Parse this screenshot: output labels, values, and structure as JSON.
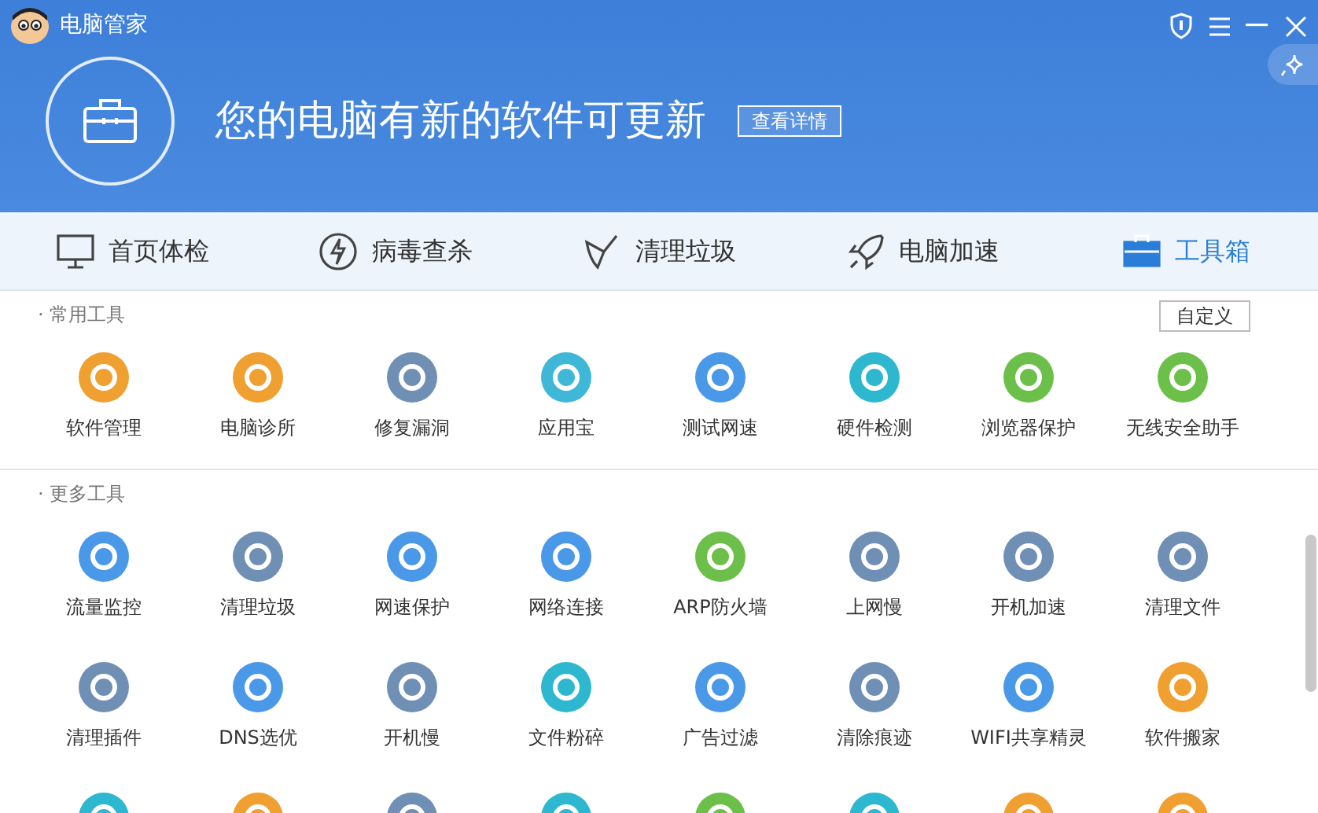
{
  "window": {
    "title": "电脑管家"
  },
  "banner": {
    "headline": "您的电脑有新的软件可更新",
    "button": "查看详情"
  },
  "nav": [
    {
      "label": "首页体检",
      "kind": "monitor",
      "selected": false
    },
    {
      "label": "病毒查杀",
      "kind": "bolt",
      "selected": false
    },
    {
      "label": "清理垃圾",
      "kind": "broom",
      "selected": false
    },
    {
      "label": "电脑加速",
      "kind": "rocket",
      "selected": false
    },
    {
      "label": "工具箱",
      "kind": "toolbox",
      "selected": true
    }
  ],
  "sections": [
    {
      "title": "· 常用工具",
      "button": "自定义",
      "rows": [
        [
          {
            "label": "软件管理",
            "color": "#f0a030"
          },
          {
            "label": "电脑诊所",
            "color": "#f0a030"
          },
          {
            "label": "修复漏洞",
            "color": "#6f8fb5"
          },
          {
            "label": "应用宝",
            "color": "#3fb8d8"
          },
          {
            "label": "测试网速",
            "color": "#4a98e8"
          },
          {
            "label": "硬件检测",
            "color": "#2eb8d0"
          },
          {
            "label": "浏览器保护",
            "color": "#6cc04a"
          },
          {
            "label": "无线安全助手",
            "color": "#6cc04a"
          }
        ]
      ]
    },
    {
      "title": "· 更多工具",
      "rows": [
        [
          {
            "label": "流量监控",
            "color": "#4a98e8"
          },
          {
            "label": "清理垃圾",
            "color": "#6f8fb5"
          },
          {
            "label": "网速保护",
            "color": "#4a98e8"
          },
          {
            "label": "网络连接",
            "color": "#4a98e8"
          },
          {
            "label": "ARP防火墙",
            "color": "#6cc04a"
          },
          {
            "label": "上网慢",
            "color": "#6f8fb5"
          },
          {
            "label": "开机加速",
            "color": "#6f8fb5"
          },
          {
            "label": "清理文件",
            "color": "#6f8fb5"
          }
        ],
        [
          {
            "label": "清理插件",
            "color": "#6f8fb5"
          },
          {
            "label": "DNS选优",
            "color": "#4a98e8"
          },
          {
            "label": "开机慢",
            "color": "#6f8fb5"
          },
          {
            "label": "文件粉碎",
            "color": "#2eb8d0"
          },
          {
            "label": "广告过滤",
            "color": "#4a98e8"
          },
          {
            "label": "清除痕迹",
            "color": "#6f8fb5"
          },
          {
            "label": "WIFI共享精灵",
            "color": "#4a98e8"
          },
          {
            "label": "软件搬家",
            "color": "#f0a030"
          }
        ],
        [
          {
            "color": "#2eb8d0"
          },
          {
            "color": "#f0a030"
          },
          {
            "color": "#6f8fb5"
          },
          {
            "color": "#2eb8d0"
          },
          {
            "color": "#6cc04a"
          },
          {
            "color": "#2eb8d0"
          },
          {
            "color": "#f0a030"
          },
          {
            "color": "#f0a030"
          }
        ]
      ]
    }
  ]
}
